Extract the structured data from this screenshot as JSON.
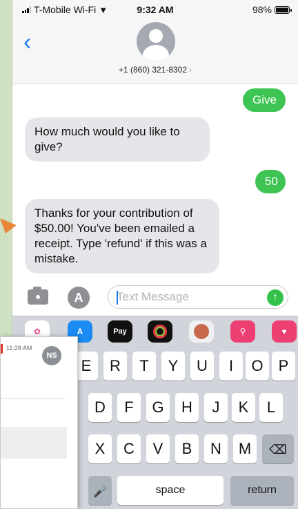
{
  "status": {
    "carrier": "T-Mobile Wi-Fi",
    "time": "9:32 AM",
    "battery": "98%",
    "battery_level": 0.98
  },
  "contact": {
    "phone": "+1 (860) 321-8302"
  },
  "messages": [
    {
      "direction": "sent",
      "text": "Give"
    },
    {
      "direction": "received",
      "text": "How much would you like to give?"
    },
    {
      "direction": "sent",
      "text": "50"
    },
    {
      "direction": "received",
      "text": "Thanks for your contribution of $50.00!  You've been emailed a receipt.  Type 'refund' if this was a mistake."
    }
  ],
  "input": {
    "placeholder": "Text Message",
    "value": ""
  },
  "apps": [
    "Photos",
    "App Store",
    "Apple Pay",
    "Activity",
    "Memoji",
    "Web Search",
    "Digital Touch"
  ],
  "apple_pay_label": "Pay",
  "keyboard": {
    "row1": [
      "E",
      "R",
      "T",
      "Y",
      "U",
      "I",
      "O",
      "P"
    ],
    "row2": [
      "D",
      "F",
      "G",
      "H",
      "J",
      "K",
      "L"
    ],
    "row3": [
      "X",
      "C",
      "V",
      "B",
      "N",
      "M"
    ],
    "space": "space",
    "return": "return",
    "delete_icon": "delete-icon",
    "mic_icon": "microphone-icon"
  },
  "notification": {
    "time": "11:28 AM",
    "initials": "NS"
  },
  "colors": {
    "sent_bubble": "#3ec452",
    "received_bubble": "#e6e6ea",
    "ios_blue": "#1a7cf0",
    "send_button": "#35c24a",
    "callout_arrow": "#e8863a"
  }
}
